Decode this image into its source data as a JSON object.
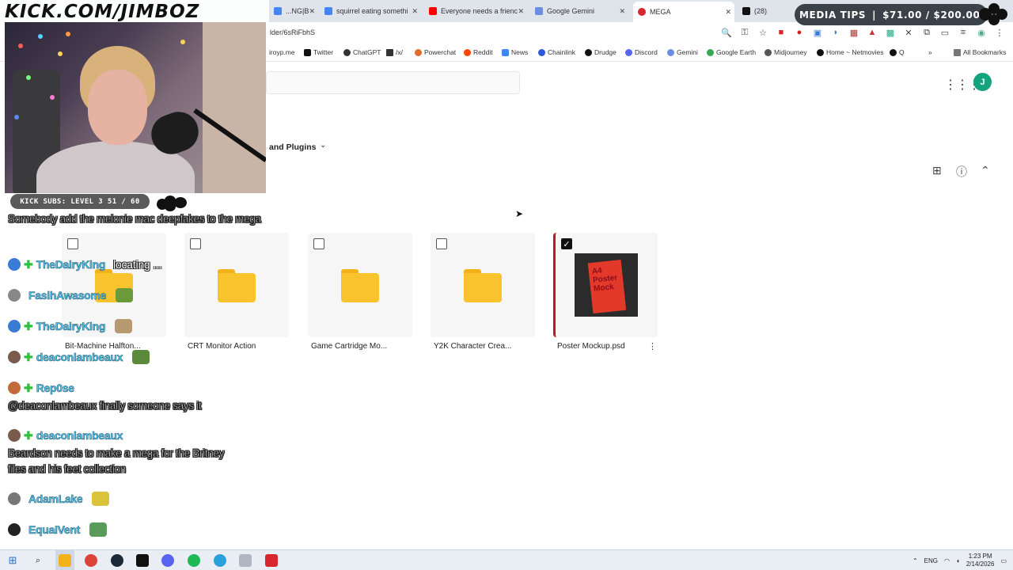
{
  "browser": {
    "tabs": [
      {
        "title": "...NG|B",
        "color": "#4285f4"
      },
      {
        "title": "squirrel eating somethi",
        "color": "#4285f4"
      },
      {
        "title": "Everyone needs a frienc",
        "color": "#ff0000"
      },
      {
        "title": "Google Gemini",
        "color": "#6b8de6"
      },
      {
        "title": "MEGA",
        "color": "#d9272e",
        "active": true
      },
      {
        "title": "(28)",
        "color": "#111111"
      }
    ],
    "url": "lder/6sRiFbhS",
    "bookmarks": [
      {
        "label": "iroyp.me",
        "color": "#888888"
      },
      {
        "label": "Twitter",
        "color": "#111111"
      },
      {
        "label": "ChatGPT",
        "color": "#333333"
      },
      {
        "label": "/x/",
        "color": "#333333"
      },
      {
        "label": "Powerchat",
        "color": "#e06b2a"
      },
      {
        "label": "Reddit",
        "color": "#ff4500"
      },
      {
        "label": "News",
        "color": "#4285f4"
      },
      {
        "label": "Chainlink",
        "color": "#2a5ada"
      },
      {
        "label": "Drudge",
        "color": "#111111"
      },
      {
        "label": "Discord",
        "color": "#5865f2"
      },
      {
        "label": "Gemini",
        "color": "#6b8de6"
      },
      {
        "label": "Google Earth",
        "color": "#34a853"
      },
      {
        "label": "Midjourney",
        "color": "#555555"
      },
      {
        "label": "Home ~ Netmovies",
        "color": "#111111"
      },
      {
        "label": "Q",
        "color": "#111111"
      }
    ],
    "all_bookmarks": "All Bookmarks"
  },
  "mega": {
    "breadcrumb": "and Plugins",
    "avatar_letter": "J",
    "items": [
      {
        "name": "Bit-Machine Halfton...",
        "type": "folder",
        "checked": false
      },
      {
        "name": "CRT Monitor Action",
        "type": "folder",
        "checked": false
      },
      {
        "name": "Game Cartridge Mo...",
        "type": "folder",
        "checked": false
      },
      {
        "name": "Y2K Character Crea...",
        "type": "folder",
        "checked": false
      },
      {
        "name": "Poster Mockup.psd",
        "type": "file",
        "checked": true,
        "thumb_text": "A4 Poster Mock"
      }
    ]
  },
  "overlay": {
    "logo": "KICK.COM/JIMBOZ",
    "media_tips_label": "MEDIA TIPS",
    "media_tips_amount": "$71.00 / $200.00",
    "kick_subs": "KICK SUBS: LEVEL 3 51 / 60",
    "chat_top_message": "Somebody add the melonie mac deepfakes to the mega",
    "chat": [
      {
        "user": "TheDairyKing",
        "msg": "locating ...",
        "badge": true,
        "avatar": "#3a7bd5",
        "emote": ""
      },
      {
        "user": "FasihAwasome",
        "msg": "",
        "badge": false,
        "avatar": "#888888",
        "emote": "#6a9a3a"
      },
      {
        "user": "TheDairyKing",
        "msg": "",
        "badge": true,
        "avatar": "#3a7bd5",
        "emote": "#b89a70"
      },
      {
        "user": "deaconlambeaux",
        "msg": "",
        "badge": true,
        "avatar": "#7a5a4a",
        "emote": "#5a8a3a"
      },
      {
        "user": "Rep0se",
        "msg": "",
        "badge": true,
        "avatar": "#c26a3a",
        "emote": ""
      },
      {
        "user": "deaconlambeaux",
        "msg": "",
        "badge": true,
        "avatar": "#7a5a4a",
        "emote": ""
      },
      {
        "user": "AdamLake",
        "msg": "",
        "badge": false,
        "avatar": "#777777",
        "emote": "#d8c33a"
      },
      {
        "user": "EquaIVent",
        "msg": "",
        "badge": false,
        "avatar": "#222222",
        "emote": "#5a9a5a"
      }
    ],
    "chat_line_reply": "@deaconlambeaux finally someone says it",
    "chat_line_beardson": "Beardson needs to make a mega for the Britney files and his feet collection"
  },
  "taskbar": {
    "lang": "ENG",
    "time": "1:23 PM",
    "date": "2/14/2026"
  }
}
